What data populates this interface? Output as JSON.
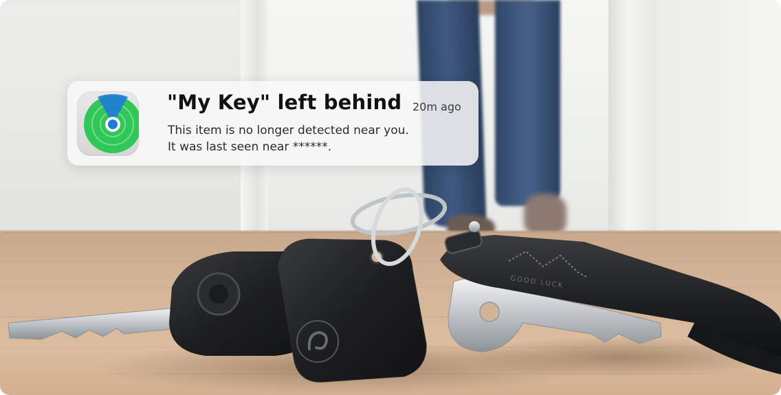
{
  "notification": {
    "app_icon": "find-my-radar-icon",
    "title": "\"My Key\" left behind",
    "time": "20m ago",
    "body_line1": "This item is no longer detected near you.",
    "body_line2": "It was last seen near ******."
  },
  "keychain": {
    "fob_engraving": "GOOD LUCK",
    "tracker_logo": "tracker-logo-icon"
  },
  "colors": {
    "icon_green": "#30c758",
    "icon_blue": "#1e7bd6",
    "leg_denim": "#3a5479",
    "table_wood": "#d4b497"
  }
}
